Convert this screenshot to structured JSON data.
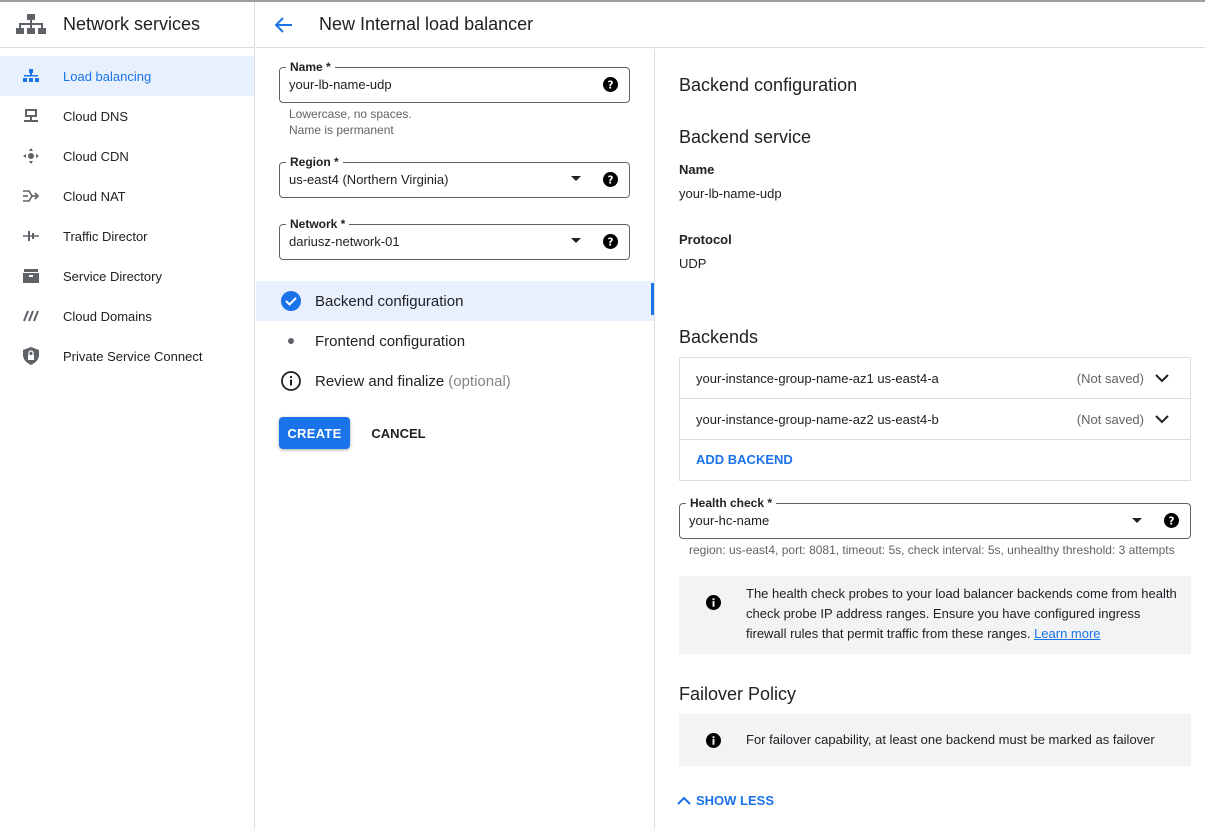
{
  "sidebar": {
    "title": "Network services",
    "items": [
      {
        "label": "Load balancing",
        "icon": "load-balancing-icon"
      },
      {
        "label": "Cloud DNS",
        "icon": "cloud-dns-icon"
      },
      {
        "label": "Cloud CDN",
        "icon": "cloud-cdn-icon"
      },
      {
        "label": "Cloud NAT",
        "icon": "cloud-nat-icon"
      },
      {
        "label": "Traffic Director",
        "icon": "traffic-director-icon"
      },
      {
        "label": "Service Directory",
        "icon": "service-directory-icon"
      },
      {
        "label": "Cloud Domains",
        "icon": "cloud-domains-icon"
      },
      {
        "label": "Private Service Connect",
        "icon": "private-service-connect-icon"
      }
    ]
  },
  "header": {
    "title": "New Internal load balancer"
  },
  "form": {
    "name": {
      "label": "Name *",
      "value": "your-lb-name-udp",
      "hint1": "Lowercase, no spaces.",
      "hint2": "Name is permanent"
    },
    "region": {
      "label": "Region *",
      "value": "us-east4 (Northern Virginia)"
    },
    "network": {
      "label": "Network *",
      "value": "dariusz-network-01"
    }
  },
  "steps": [
    {
      "label": "Backend configuration",
      "suffix": ""
    },
    {
      "label": "Frontend configuration",
      "suffix": ""
    },
    {
      "label": "Review and finalize",
      "suffix": "(optional)"
    }
  ],
  "actions": {
    "create": "CREATE",
    "cancel": "CANCEL"
  },
  "backend_config": {
    "title": "Backend configuration",
    "service_title": "Backend service",
    "name_label": "Name",
    "name_value": "your-lb-name-udp",
    "protocol_label": "Protocol",
    "protocol_value": "UDP",
    "backends_title": "Backends",
    "backends": [
      {
        "name": "your-instance-group-name-az1 us-east4-a",
        "status": "(Not saved)"
      },
      {
        "name": "your-instance-group-name-az2 us-east4-b",
        "status": "(Not saved)"
      }
    ],
    "add_backend": "ADD BACKEND",
    "health_check": {
      "label": "Health check *",
      "value": "your-hc-name",
      "hint": "region: us-east4, port: 8081, timeout: 5s, check interval: 5s, unhealthy threshold: 3 attempts"
    },
    "hc_info": "The health check probes to your load balancer backends come from health check probe IP address ranges. Ensure you have configured ingress firewall rules that permit traffic from these ranges.",
    "hc_info_link": "Learn more",
    "failover_title": "Failover Policy",
    "failover_info": "For failover capability, at least one backend must be marked as failover",
    "show_less": "SHOW LESS"
  },
  "colors": {
    "accent": "#1a73e8",
    "active_bg": "#e8f0fe",
    "info_bg": "#f1f3f4"
  }
}
